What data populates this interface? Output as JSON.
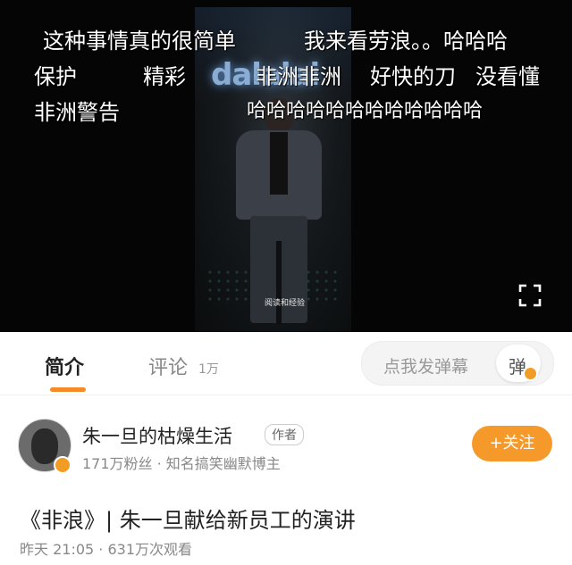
{
  "video": {
    "stage_brand": "dalalai",
    "stage_caption": "阅读和经验",
    "danmaku": [
      "这种事情真的很简单",
      "我来看劳浪。。哈哈哈",
      "保护",
      "精彩",
      "非洲非洲",
      "好快的刀",
      "没看懂",
      "非洲警告",
      "哈哈哈哈哈哈哈哈哈哈哈哈"
    ]
  },
  "tabs": {
    "intro_label": "简介",
    "comments_label": "评论",
    "comments_count": "1万",
    "danmaku_placeholder": "点我发弹幕",
    "danmaku_button_label": "弹"
  },
  "author": {
    "name": "朱一旦的枯燥生活",
    "tag": "作者",
    "meta": "171万粉丝 · 知名搞笑幽默博主",
    "follow_label": "+关注"
  },
  "content": {
    "title": "《非浪》| 朱一旦献给新员工的演讲",
    "meta": "昨天 21:05 · 631万次观看"
  },
  "colors": {
    "accent": "#f58b27",
    "follow": "#f59a2a"
  }
}
